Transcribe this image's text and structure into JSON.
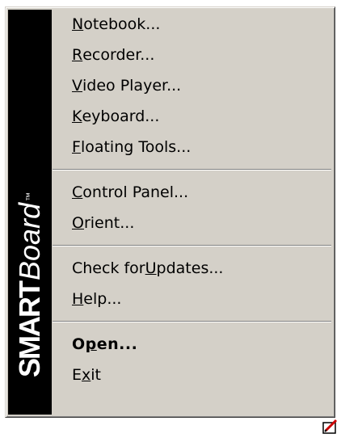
{
  "brand": {
    "smart": "SMART",
    "board": "Board",
    "tm": "™"
  },
  "menu": {
    "groups": [
      [
        {
          "pre": "",
          "key": "N",
          "post": "otebook..."
        },
        {
          "pre": "",
          "key": "R",
          "post": "ecorder..."
        },
        {
          "pre": "",
          "key": "V",
          "post": "ideo Player..."
        },
        {
          "pre": "",
          "key": "K",
          "post": "eyboard..."
        },
        {
          "pre": "",
          "key": "F",
          "post": "loating Tools..."
        }
      ],
      [
        {
          "pre": "",
          "key": "C",
          "post": "ontrol Panel..."
        },
        {
          "pre": "",
          "key": "O",
          "post": "rient..."
        }
      ],
      [
        {
          "pre": "Check for ",
          "key": "U",
          "post": "pdates..."
        },
        {
          "pre": "",
          "key": "H",
          "post": "elp..."
        }
      ],
      [
        {
          "pre": "O",
          "key": "p",
          "post": "en..."
        },
        {
          "pre": "E",
          "key": "x",
          "post": "it"
        }
      ]
    ]
  },
  "icons": {
    "tray": "smartboard-tray-icon"
  },
  "colors": {
    "menu_bg": "#d4d0c8",
    "brand_bg": "#000000",
    "tray_red": "#cc0000"
  }
}
